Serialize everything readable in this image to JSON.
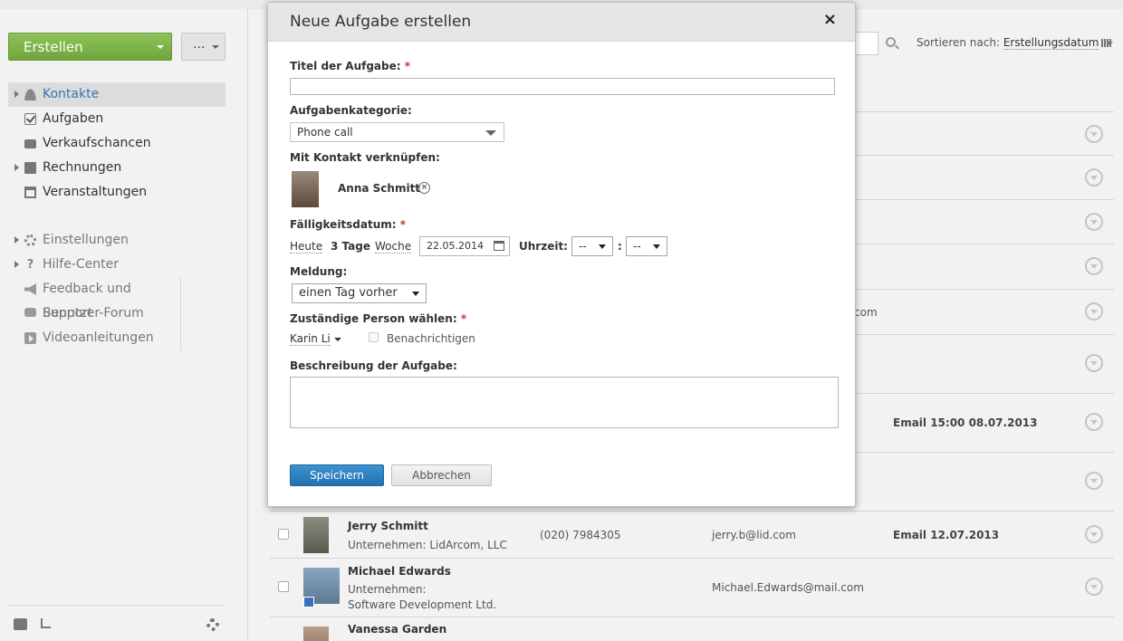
{
  "sidebar": {
    "create_label": "Erstellen",
    "more_label": "...",
    "nav": [
      {
        "label": "Kontakte",
        "icon": "user-icon"
      },
      {
        "label": "Aufgaben",
        "icon": "check-icon"
      },
      {
        "label": "Verkaufschancen",
        "icon": "briefcase-icon"
      },
      {
        "label": "Rechnungen",
        "icon": "document-icon"
      },
      {
        "label": "Veranstaltungen",
        "icon": "calendar-icon"
      }
    ],
    "settings_label": "Einstellungen",
    "help_label": "Hilfe-Center",
    "help_items": [
      {
        "label": "Feedback und Support",
        "icon": "megaphone-icon"
      },
      {
        "label": "Benutzer-Forum",
        "icon": "bubble-icon"
      },
      {
        "label": "Videoanleitungen",
        "icon": "video-icon"
      }
    ]
  },
  "main": {
    "sort_label": "Sortieren nach:",
    "sort_value": "Erstellungsdatum",
    "partial_com": "com",
    "row_email_1": "Email 15:00 08.07.2013",
    "rows": [
      {
        "name": "Jerry Schmitt",
        "company": "Unternehmen: LidArcom, LLC",
        "phone": "(020) 7984305",
        "email": "jerry.b@lid.com",
        "activity": "Email 12.07.2013"
      },
      {
        "name": "Michael Edwards",
        "company_label": "Unternehmen:",
        "company": "Software Development Ltd.",
        "email": "Michael.Edwards@mail.com"
      },
      {
        "name": "Vanessa Garden"
      }
    ]
  },
  "modal": {
    "title": "Neue Aufgabe erstellen",
    "close": "×",
    "title_label": "Titel der Aufgabe:",
    "required_mark": "*",
    "title_value": "",
    "category_label": "Aufgabenkategorie:",
    "category_value": "Phone call",
    "contact_label": "Mit Kontakt verknüpfen:",
    "contact_name": "Anna Schmitt",
    "due_label": "Fälligkeitsdatum:",
    "due_today": "Heute",
    "due_3days": "3 Tage",
    "due_week": "Woche",
    "due_date": "22.05.2014",
    "time_label": "Uhrzeit:",
    "hour": "--",
    "minute": "--",
    "time_sep": ":",
    "reminder_label": "Meldung:",
    "reminder_value": "einen Tag vorher",
    "assignee_label": "Zuständige Person wählen:",
    "assignee_value": "Karin Li",
    "notify_label": "Benachrichtigen",
    "description_label": "Beschreibung der Aufgabe:",
    "save_label": "Speichern",
    "cancel_label": "Abbrechen"
  }
}
